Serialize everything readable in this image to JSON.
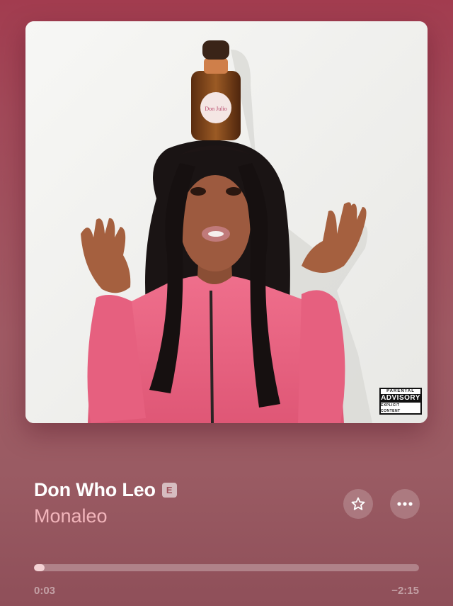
{
  "now_playing": {
    "title": "Don Who Leo",
    "explicit_badge": "E",
    "artist": "Monaleo",
    "progress_fraction": 0.028,
    "time_elapsed": "0:03",
    "time_remaining": "−2:15"
  },
  "artwork": {
    "advisory": {
      "top": "PARENTAL",
      "middle": "ADVISORY",
      "bottom": "EXPLICIT CONTENT"
    },
    "bottle_label": "Don Julio"
  },
  "controls": {
    "favorite_icon": "star-icon",
    "more_icon": "ellipsis-icon"
  },
  "colors": {
    "background_top": "#a23c4f",
    "background_bottom": "#8f4f59",
    "artist_text": "#f2b5bb",
    "progress_fill": "#f3d2d4",
    "hoodie": "#e7607e"
  }
}
